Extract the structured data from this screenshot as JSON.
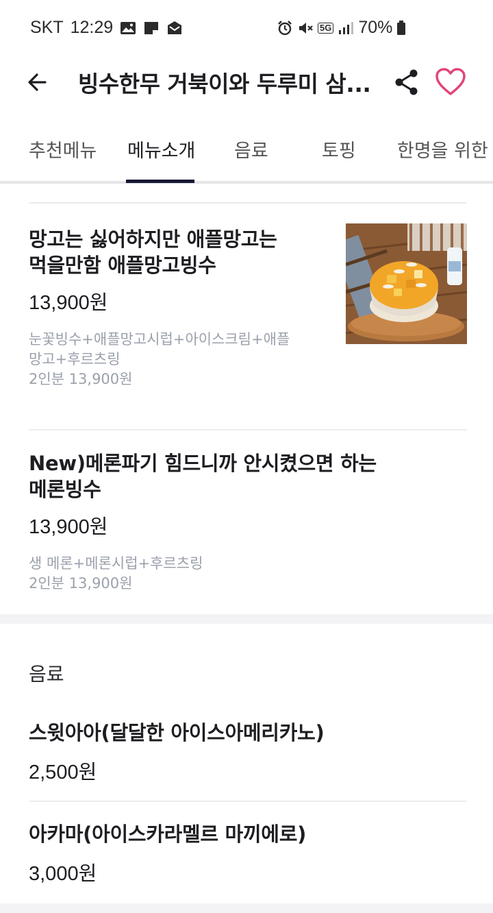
{
  "status_bar": {
    "carrier": "SKT",
    "time": "12:29",
    "network": "5G",
    "battery": "70%"
  },
  "header": {
    "title": "빙수한무 거북이와 두루미 삼..."
  },
  "tabs": [
    {
      "label": "추천메뉴"
    },
    {
      "label": "메뉴소개"
    },
    {
      "label": "음료"
    },
    {
      "label": "토핑"
    },
    {
      "label": "한명을 위한"
    }
  ],
  "active_tab": "메뉴소개",
  "menu_items": [
    {
      "name_line1": "망고는 싫어하지만 애플망고는",
      "name_line2": "먹을만함 애플망고빙수",
      "price": "13,900원",
      "desc_line1": "눈꽃빙수+애플망고시럽+아이스크림+애플",
      "desc_line2": "망고+후르츠링",
      "serving": "2인분 13,900원"
    },
    {
      "name_line1": "New)메론파기 힘드니까 안시켰으면 하는",
      "name_line2": "메론빙수",
      "price": "13,900원",
      "desc_line1": "생 메론+메론시럽+후르츠링",
      "serving": "2인분 13,900원"
    }
  ],
  "drinks_section": {
    "title": "음료",
    "items": [
      {
        "name": "스윗아아(달달한 아이스아메리카노)",
        "price": "2,500원"
      },
      {
        "name": "아카마(아이스카라멜르 마끼에로)",
        "price": "3,000원"
      }
    ]
  },
  "colors": {
    "accent_heart": "#e0457b",
    "tab_indicator": "#161635",
    "desc_text": "#9aa0ab"
  },
  "icons": [
    "back-arrow-icon",
    "share-icon",
    "heart-icon",
    "gallery-icon",
    "note-icon",
    "mail-icon",
    "alarm-icon",
    "mute-icon",
    "signal-icon",
    "battery-icon"
  ]
}
